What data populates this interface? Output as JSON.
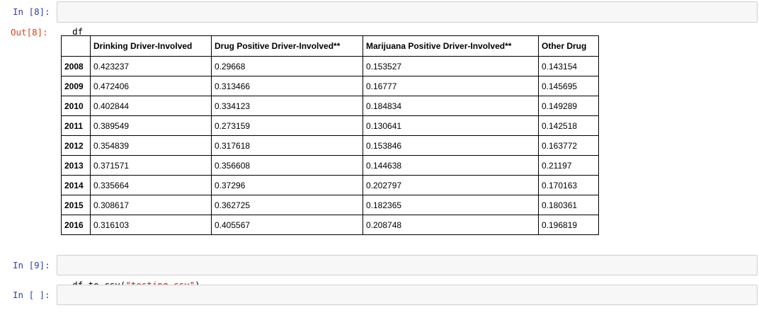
{
  "cells": {
    "in8": {
      "prompt": "In [8]:",
      "code": "df"
    },
    "out8": {
      "prompt": "Out[8]:"
    },
    "in9": {
      "prompt": "In [9]:",
      "code_prefix": "df.to_csv(",
      "code_string": "\"testing.csv\"",
      "code_suffix": ")"
    },
    "in_empty": {
      "prompt": "In [ ]:",
      "code": ""
    }
  },
  "table": {
    "columns": [
      "",
      "Drinking Driver-Involved",
      "Drug Positive Driver-Involved**",
      "Marijuana Positive Driver-Involved**",
      "Other Drug"
    ],
    "rows": [
      [
        "2008",
        "0.423237",
        "0.29668",
        "0.153527",
        "0.143154"
      ],
      [
        "2009",
        "0.472406",
        "0.313466",
        "0.16777",
        "0.145695"
      ],
      [
        "2010",
        "0.402844",
        "0.334123",
        "0.184834",
        "0.149289"
      ],
      [
        "2011",
        "0.389549",
        "0.273159",
        "0.130641",
        "0.142518"
      ],
      [
        "2012",
        "0.354839",
        "0.317618",
        "0.153846",
        "0.163772"
      ],
      [
        "2013",
        "0.371571",
        "0.356608",
        "0.144638",
        "0.21197"
      ],
      [
        "2014",
        "0.335664",
        "0.37296",
        "0.202797",
        "0.170163"
      ],
      [
        "2015",
        "0.308617",
        "0.362725",
        "0.182365",
        "0.180361"
      ],
      [
        "2016",
        "0.316103",
        "0.405567",
        "0.208748",
        "0.196819"
      ]
    ]
  },
  "colors": {
    "in_prompt": "#303f9f",
    "out_prompt": "#d84315",
    "code_bg": "#f7f7f7",
    "string": "#ba2121"
  }
}
